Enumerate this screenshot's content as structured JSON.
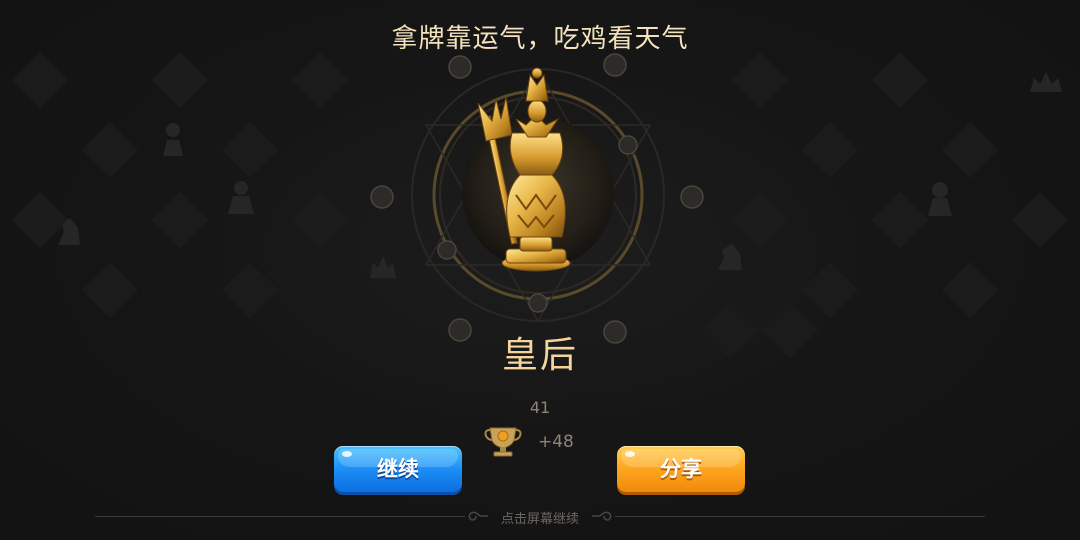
{
  "header": {
    "slogan": "拿牌靠运气，吃鸡看天气"
  },
  "result": {
    "piece_name": "皇后",
    "piece_icon": "queen-chess-piece-icon",
    "score_total": "41",
    "score_delta": "+48",
    "trophy_icon": "trophy-icon"
  },
  "buttons": {
    "continue_label": "继续",
    "share_label": "分享"
  },
  "footer": {
    "hint": "点击屏幕继续"
  },
  "colors": {
    "slogan": "#f3e2bd",
    "title_gold": "#f5d59c",
    "continue_blue": "#1c8ff5",
    "share_orange": "#ffa41f"
  }
}
